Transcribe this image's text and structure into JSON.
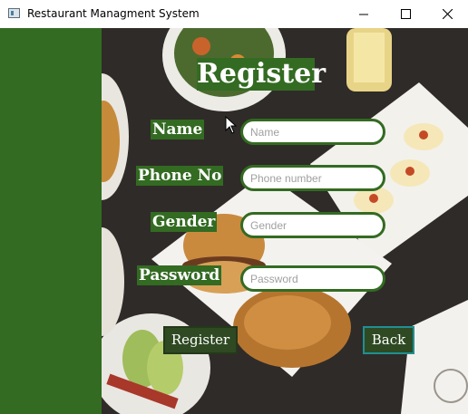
{
  "window": {
    "title": "Restaurant Managment System",
    "icon": "app-window-icon"
  },
  "form": {
    "title": "Register",
    "fields": [
      {
        "label": "Name",
        "placeholder": "Name"
      },
      {
        "label": "Phone No",
        "placeholder": "Phone number"
      },
      {
        "label": "Gender",
        "placeholder": "Gender"
      },
      {
        "label": "Password",
        "placeholder": "Password"
      }
    ],
    "register_label": "Register",
    "back_label": "Back"
  },
  "colors": {
    "sidebar_green": "#336b22",
    "button_dark": "#2f4a23",
    "back_border": "#1f8f94"
  }
}
